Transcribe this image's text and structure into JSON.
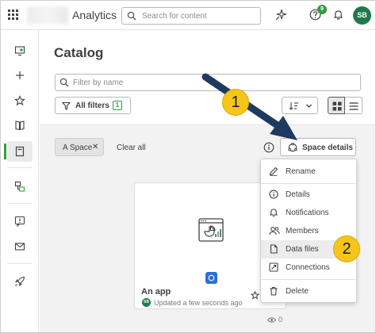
{
  "topbar": {
    "app_name": "Analytics",
    "search_placeholder": "Search for content",
    "help_badge": "9",
    "avatar_initials": "SB"
  },
  "page": {
    "title": "Catalog",
    "filter_placeholder": "Filter by name",
    "all_filters_label": "All filters",
    "all_filters_count": "1"
  },
  "filters": {
    "chip_label": "A Space",
    "chip_remove": "✕",
    "clear_all": "Clear all",
    "space_details": "Space details"
  },
  "space_menu": {
    "items": [
      {
        "label": "Rename",
        "icon": "pencil-icon"
      },
      {
        "label": "Details",
        "icon": "info-icon"
      },
      {
        "label": "Notifications",
        "icon": "bell-icon"
      },
      {
        "label": "Members",
        "icon": "members-icon"
      },
      {
        "label": "Data files",
        "icon": "file-icon"
      },
      {
        "label": "Connections",
        "icon": "connections-icon"
      },
      {
        "label": "Delete",
        "icon": "trash-icon"
      }
    ],
    "highlighted": "Data files"
  },
  "app_card": {
    "name": "An app",
    "owner_initials": "SB",
    "updated": "Updated a few seconds ago",
    "views": "0"
  },
  "callouts": {
    "first": "1",
    "second": "2"
  },
  "colors": {
    "accent_green": "#2f9e44",
    "callout_yellow": "#f5c51a",
    "arrow_navy": "#1f3a5f",
    "space_badge_blue": "#2a6fd6"
  }
}
